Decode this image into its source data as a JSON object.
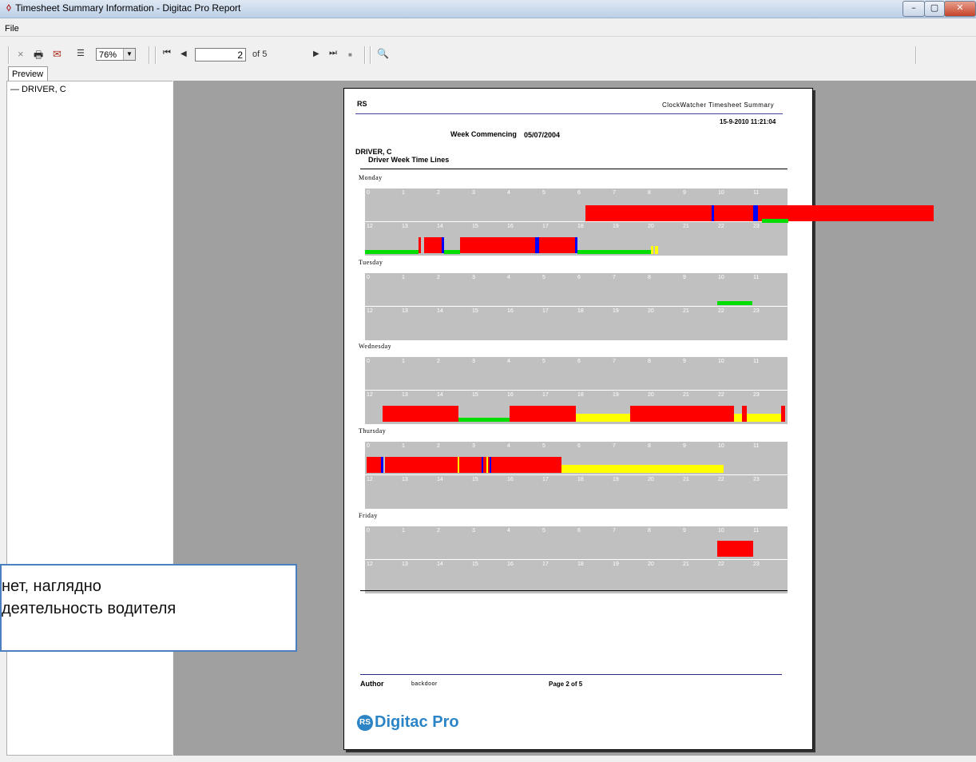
{
  "window": {
    "title": "Timesheet Summary Information - Digitac Pro Report",
    "controls": {
      "minimize": "–",
      "maximize": "▢",
      "close": "✕"
    }
  },
  "menu": {
    "file": "File"
  },
  "toolbar": {
    "close_icon": "×",
    "print_icon": "🖶",
    "export_icon": "✉",
    "tree_icon": "☰",
    "zoom": "76%",
    "first_icon": "⏮",
    "prev_icon": "◀",
    "page_input": "2",
    "page_of": "of 5",
    "next_icon": "▶",
    "last_icon": "⏭",
    "stop_icon": "■",
    "find_icon": "🔍"
  },
  "tab": {
    "label": "Preview"
  },
  "tree": {
    "node": "— DRIVER, C"
  },
  "report": {
    "company": "RS",
    "report_title": "ClockWatcher Timesheet Summary",
    "printed": "15-9-2010  11:21:04",
    "week_label": "Week Commencing",
    "week_date": "05/07/2004",
    "driver": "DRIVER, C",
    "section": "Driver Week Time Lines",
    "hours_top": [
      "0",
      "1",
      "2",
      "3",
      "4",
      "5",
      "6",
      "7",
      "8",
      "9",
      "10",
      "11"
    ],
    "hours_bottom": [
      "12",
      "13",
      "14",
      "15",
      "16",
      "17",
      "18",
      "19",
      "20",
      "21",
      "22",
      "23"
    ],
    "days": [
      {
        "name": "Monday"
      },
      {
        "name": "Tuesday"
      },
      {
        "name": "Wednesday"
      },
      {
        "name": "Thursday"
      },
      {
        "name": "Friday"
      }
    ],
    "footer_author_label": "Author",
    "footer_author": "backdoor",
    "footer_page": "Page 2 of 5",
    "logo_text": "Digitac Pro",
    "logo_mark": "RS"
  },
  "callout": {
    "line1": "нет, наглядно",
    "line2": "деятельность водителя"
  },
  "colors": {
    "driving": "#ff0000",
    "break": "#0000ff",
    "rest": "#00dd00",
    "other_work": "#ffff00",
    "grid": "#c0c0c0"
  }
}
